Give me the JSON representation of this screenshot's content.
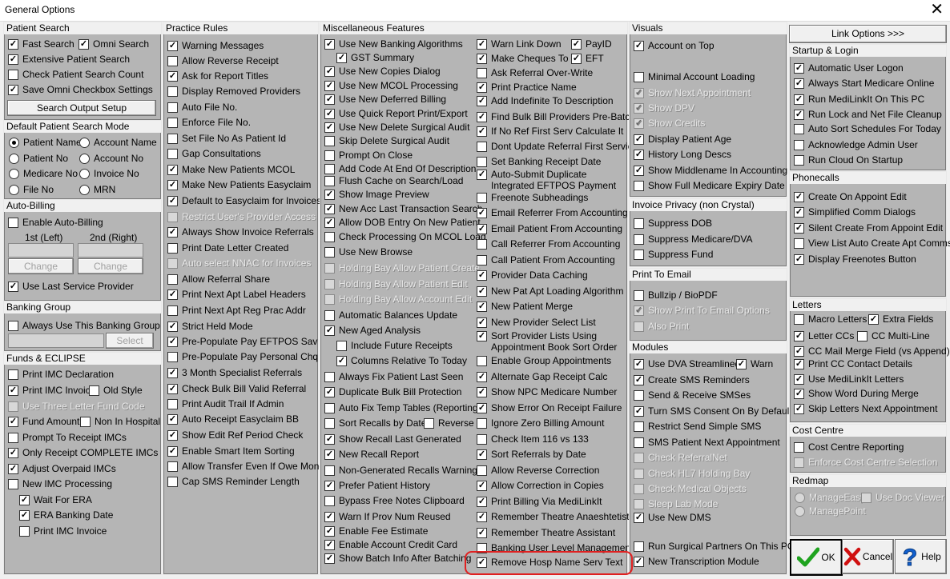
{
  "window": {
    "title": "General Options",
    "close_glyph": "✕"
  },
  "colors": {
    "panel_bg": "#b5b5b5",
    "highlight": "#e02020",
    "ok_check": "#1fa31f",
    "cancel_x": "#d01010",
    "help_q": "#1060d0"
  },
  "patient_search": {
    "title": "Patient Search",
    "items": [
      {
        "label": "Fast Search",
        "checked": true
      },
      {
        "label": "Omni Search",
        "checked": true
      },
      {
        "label": "Extensive Patient Search",
        "checked": true
      },
      {
        "label": "Check Patient Search Count",
        "checked": false
      },
      {
        "label": "Save Omni Checkbox Settings",
        "checked": true
      }
    ],
    "output_button": "Search Output Setup"
  },
  "default_search_mode": {
    "title": "Default Patient Search Mode",
    "options": [
      {
        "label": "Patient Name",
        "selected": true
      },
      {
        "label": "Account Name",
        "selected": false
      },
      {
        "label": "Patient No",
        "selected": false
      },
      {
        "label": "Account No",
        "selected": false
      },
      {
        "label": "Medicare No",
        "selected": false
      },
      {
        "label": "Invoice No",
        "selected": false
      },
      {
        "label": "File No",
        "selected": false
      },
      {
        "label": "MRN",
        "selected": false
      }
    ]
  },
  "auto_billing": {
    "title": "Auto-Billing",
    "enable": {
      "label": "Enable Auto-Billing",
      "checked": false
    },
    "first_label": "1st (Left)",
    "second_label": "2nd (Right)",
    "change1": "Change",
    "change2": "Change",
    "last_provider": {
      "label": "Use Last Service Provider",
      "checked": true
    }
  },
  "banking_group": {
    "title": "Banking Group",
    "always": {
      "label": "Always Use This Banking Group",
      "checked": false
    },
    "select_button": "Select"
  },
  "funds": {
    "title": "Funds & ECLIPSE",
    "items": [
      {
        "label": "Print IMC Declaration",
        "checked": false
      },
      {
        "label": "Print IMC Invoice",
        "checked": true
      },
      {
        "label": "Old Style",
        "checked": false
      },
      {
        "label": "Use Three Letter Fund Code",
        "checked": false,
        "disabled": true
      },
      {
        "label": "Fund Amount",
        "checked": true
      },
      {
        "label": "Non In Hospital",
        "checked": false
      },
      {
        "label": "Prompt To Receipt IMCs",
        "checked": false
      },
      {
        "label": "Only Receipt COMPLETE IMCs",
        "checked": true
      },
      {
        "label": "Adjust Overpaid IMCs",
        "checked": true
      },
      {
        "label": "New IMC Processing",
        "checked": false
      },
      {
        "label": "Wait For ERA",
        "checked": true
      },
      {
        "label": "ERA Banking Date",
        "checked": true
      },
      {
        "label": "Print IMC Invoice",
        "checked": false
      }
    ]
  },
  "practice_rules": {
    "title": "Practice Rules",
    "items": [
      {
        "label": "Warning Messages",
        "checked": true
      },
      {
        "label": "Allow Reverse Receipt",
        "checked": false
      },
      {
        "label": "Ask for Report Titles",
        "checked": true
      },
      {
        "label": "Display Removed Providers",
        "checked": false
      },
      {
        "label": "Auto File No.",
        "checked": false
      },
      {
        "label": "Enforce File No.",
        "checked": false
      },
      {
        "label": "Set File No As Patient Id",
        "checked": false
      },
      {
        "label": "Gap Consultations",
        "checked": false
      },
      {
        "label": "Make New Patients MCOL",
        "checked": true
      },
      {
        "label": "Make New Patients Easyclaim",
        "checked": true
      },
      {
        "label": "Default to Easyclaim for Invoices",
        "checked": true
      },
      {
        "label": "Restrict User's Provider Access",
        "checked": false,
        "disabled": true
      },
      {
        "label": "Always Show Invoice Referrals",
        "checked": true
      },
      {
        "label": "Print Date Letter Created",
        "checked": false
      },
      {
        "label": "Auto select NNAC for Invoices",
        "checked": false,
        "disabled": true
      },
      {
        "label": "Allow Referral Share",
        "checked": false
      },
      {
        "label": "Print Next Apt Label Headers",
        "checked": true
      },
      {
        "label": "Print Next Apt Reg Prac Addr",
        "checked": false
      },
      {
        "label": "Strict Held Mode",
        "checked": true
      },
      {
        "label": "Pre-Populate Pay EFTPOS Sav",
        "checked": true
      },
      {
        "label": "Pre-Populate Pay Personal Chq",
        "checked": false
      },
      {
        "label": "3 Month Specialist Referrals",
        "checked": true
      },
      {
        "label": "Check Bulk Bill Valid Referral",
        "checked": true
      },
      {
        "label": "Print Audit Trail If Admin",
        "checked": false
      },
      {
        "label": "Auto Receipt Easyclaim BB",
        "checked": true
      },
      {
        "label": "Show Edit Ref Period Check",
        "checked": true
      },
      {
        "label": "Enable Smart Item Sorting",
        "checked": true
      },
      {
        "label": "Allow Transfer Even If Owe Money",
        "checked": false
      },
      {
        "label": "Cap SMS Reminder Length",
        "checked": false
      }
    ]
  },
  "misc": {
    "title": "Miscellaneous Features",
    "col1": [
      {
        "label": "Use New Banking Algorithms",
        "checked": true
      },
      {
        "label": "GST Summary",
        "checked": true
      },
      {
        "label": "Use New Copies Dialog",
        "checked": true
      },
      {
        "label": "Use New MCOL Processing",
        "checked": true
      },
      {
        "label": "Use New Deferred Billing",
        "checked": true
      },
      {
        "label": "Use Quick Report Print/Export",
        "checked": true
      },
      {
        "label": "Use New Delete Surgical Audit",
        "checked": true
      },
      {
        "label": "Skip Delete Surgical Audit",
        "checked": false
      },
      {
        "label": "Prompt On Close",
        "checked": false
      },
      {
        "label": "Add Code At End Of Description",
        "checked": false
      },
      {
        "label": "Flush Cache on Search/Load",
        "checked": false
      },
      {
        "label": "Show Image Preview",
        "checked": true
      },
      {
        "label": "New Acc Last Transaction Search",
        "checked": true
      },
      {
        "label": "Allow DOB Entry On New Patient",
        "checked": true
      },
      {
        "label": "Check Processing On MCOL Load",
        "checked": false
      },
      {
        "label": "Use New Browse",
        "checked": false
      },
      {
        "label": "Holding Bay Allow Patient Create",
        "checked": false,
        "disabled": true
      },
      {
        "label": "Holding Bay Allow Patient Edit",
        "checked": false,
        "disabled": true
      },
      {
        "label": "Holding Bay Allow Account Edit",
        "checked": false,
        "disabled": true
      },
      {
        "label": "Automatic Balances Update",
        "checked": false
      },
      {
        "label": "New Aged Analysis",
        "checked": true
      },
      {
        "label": "Include Future Receipts",
        "checked": false
      },
      {
        "label": "Columns Relative To Today",
        "checked": true
      },
      {
        "label": "Always Fix Patient Last Seen",
        "checked": false
      },
      {
        "label": "Duplicate Bulk Bill Protection",
        "checked": true
      },
      {
        "label": "Auto Fix Temp Tables (Reporting)",
        "checked": false
      },
      {
        "label": "Sort Recalls by Date",
        "checked": false
      },
      {
        "label": "Reverse",
        "checked": false
      },
      {
        "label": "Show Recall Last Generated",
        "checked": true
      },
      {
        "label": "New Recall Report",
        "checked": true
      },
      {
        "label": "Non-Generated Recalls Warning",
        "checked": false
      },
      {
        "label": "Prefer Patient History",
        "checked": true
      },
      {
        "label": "Bypass Free Notes Clipboard",
        "checked": false
      },
      {
        "label": "Warn If Prov Num Reused",
        "checked": true
      },
      {
        "label": "Enable Fee Estimate",
        "checked": true
      },
      {
        "label": "Enable Account Credit Card",
        "checked": true
      },
      {
        "label": "Show Batch Info After Batching",
        "checked": true
      }
    ],
    "col2": [
      {
        "label": "Warn Link Down",
        "checked": true
      },
      {
        "label": "PayID",
        "checked": true
      },
      {
        "label": "Make Cheques To",
        "checked": true
      },
      {
        "label": "EFT",
        "checked": true
      },
      {
        "label": "Ask Referral Over-Write",
        "checked": false
      },
      {
        "label": "Print Practice Name",
        "checked": true
      },
      {
        "label": "Add Indefinite To Description",
        "checked": true
      },
      {
        "label": "Find Bulk Bill Providers Pre-Batch",
        "checked": true
      },
      {
        "label": "If No Ref First Serv Calculate It",
        "checked": true
      },
      {
        "label": "Dont Update Referral First Service",
        "checked": false
      },
      {
        "label": "Set Banking Receipt Date",
        "checked": false
      },
      {
        "label": "Auto-Submit Duplicate",
        "checked": true
      },
      {
        "label": "Integrated EFTPOS Payment",
        "checked": true
      },
      {
        "label": "Freenote Subheadings",
        "checked": false
      },
      {
        "label": "Email Referrer From Accounting",
        "checked": true
      },
      {
        "label": "Email Patient From Accounting",
        "checked": true
      },
      {
        "label": "Call Referrer From Accounting",
        "checked": false
      },
      {
        "label": "Call Patient From Accounting",
        "checked": false
      },
      {
        "label": "Provider Data Caching",
        "checked": true
      },
      {
        "label": "New Pat Apt Loading Algorithm",
        "checked": true
      },
      {
        "label": "New Patient Merge",
        "checked": true
      },
      {
        "label": "New Provider Select List",
        "checked": true
      },
      {
        "label": "Sort Provider Lists Using",
        "checked": true
      },
      {
        "label": "Appointment Book Sort Order",
        "checked": true
      },
      {
        "label": "Enable Group Appointments",
        "checked": false
      },
      {
        "label": "Alternate Gap Receipt Calc",
        "checked": true
      },
      {
        "label": "Show NPC Medicare Number",
        "checked": true
      },
      {
        "label": "Show Error On Receipt Failure",
        "checked": true
      },
      {
        "label": "Ignore Zero Billing Amount",
        "checked": false
      },
      {
        "label": "Check Item 116 vs 133",
        "checked": false
      },
      {
        "label": "Sort Referrals by Date",
        "checked": true
      },
      {
        "label": "Allow Reverse Correction",
        "checked": false
      },
      {
        "label": "Allow Correction in Copies",
        "checked": true
      },
      {
        "label": "Print Billing Via MediLinkIt",
        "checked": true
      },
      {
        "label": "Remember Theatre Anaeshtetist",
        "checked": true
      },
      {
        "label": "Remember Theatre Assistant",
        "checked": true
      },
      {
        "label": "Banking User Level Management",
        "checked": false
      },
      {
        "label": "Remove Hosp Name Serv Text",
        "checked": true
      }
    ]
  },
  "visuals": {
    "title": "Visuals",
    "items": [
      {
        "label": "Account on Top",
        "checked": true
      },
      {
        "label": "Minimal Account Loading",
        "checked": false
      },
      {
        "label": "Show Next Appointment",
        "checked": true,
        "disabled": true
      },
      {
        "label": "Show DPV",
        "checked": true,
        "disabled": true
      },
      {
        "label": "Show Credits",
        "checked": true,
        "disabled": true
      },
      {
        "label": "Display Patient Age",
        "checked": true
      },
      {
        "label": "History Long Descs",
        "checked": true
      },
      {
        "label": "Show Middlename In Accounting",
        "checked": true
      },
      {
        "label": "Show Full Medicare Expiry Date",
        "checked": false
      }
    ]
  },
  "privacy": {
    "title": "Invoice Privacy (non Crystal)",
    "items": [
      {
        "label": "Suppress DOB",
        "checked": false
      },
      {
        "label": "Suppress Medicare/DVA",
        "checked": false
      },
      {
        "label": "Suppress Fund",
        "checked": false
      }
    ]
  },
  "print_email": {
    "title": "Print To Email",
    "items": [
      {
        "label": "Bullzip / BioPDF",
        "checked": false
      },
      {
        "label": "Show Print To Email Options",
        "checked": true,
        "disabled": true
      },
      {
        "label": "Also Print",
        "checked": false,
        "disabled": true
      }
    ]
  },
  "modules": {
    "title": "Modules",
    "items": [
      {
        "label": "Use DVA Streamlined",
        "checked": true
      },
      {
        "label": "Warn",
        "checked": true
      },
      {
        "label": "Create SMS Reminders",
        "checked": true
      },
      {
        "label": "Send & Receive SMSes",
        "checked": false
      },
      {
        "label": "Turn SMS Consent On By Default",
        "checked": true
      },
      {
        "label": "Restrict Send Simple SMS",
        "checked": false
      },
      {
        "label": "SMS Patient Next Appointment",
        "checked": false
      },
      {
        "label": "Check ReferralNet",
        "checked": false,
        "disabled": true
      },
      {
        "label": "Check HL7 Holding Bay",
        "checked": false,
        "disabled": true
      },
      {
        "label": "Check Medical Objects",
        "checked": false,
        "disabled": true
      },
      {
        "label": "Sleep Lab Mode",
        "checked": false,
        "disabled": true
      },
      {
        "label": "Use New DMS",
        "checked": true
      },
      {
        "label": "Run Surgical Partners On This PC",
        "checked": false
      },
      {
        "label": "New Transcription Module",
        "checked": true
      }
    ]
  },
  "link_options": "Link Options >>>",
  "startup": {
    "title": "Startup & Login",
    "items": [
      {
        "label": "Automatic User Logon",
        "checked": true
      },
      {
        "label": "Always Start Medicare Online",
        "checked": true
      },
      {
        "label": "Run MediLinkIt On This PC",
        "checked": true
      },
      {
        "label": "Run Lock and Net File Cleanup",
        "checked": true
      },
      {
        "label": "Auto Sort Schedules For Today",
        "checked": false
      },
      {
        "label": "Acknowledge Admin User",
        "checked": false
      },
      {
        "label": "Run Cloud On Startup",
        "checked": false
      }
    ]
  },
  "phonecalls": {
    "title": "Phonecalls",
    "items": [
      {
        "label": "Create On Appoint Edit",
        "checked": true
      },
      {
        "label": "Simplified Comm Dialogs",
        "checked": true
      },
      {
        "label": "Silent Create From Appoint Edit",
        "checked": true
      },
      {
        "label": "View List Auto Create Apt Comms",
        "checked": false
      },
      {
        "label": "Display Freenotes Button",
        "checked": true
      }
    ]
  },
  "letters": {
    "title": "Letters",
    "items": [
      {
        "label": "Macro Letters",
        "checked": false
      },
      {
        "label": "Extra Fields",
        "checked": true
      },
      {
        "label": "Letter CCs",
        "checked": true
      },
      {
        "label": "CC Multi-Line",
        "checked": false
      },
      {
        "label": "CC Mail Merge Field (vs Append)",
        "checked": true
      },
      {
        "label": "Print CC Contact Details",
        "checked": true
      },
      {
        "label": "Use MediLinkIt Letters",
        "checked": true
      },
      {
        "label": "Show Word During Merge",
        "checked": true
      },
      {
        "label": "Skip Letters Next Appointment",
        "checked": true
      }
    ]
  },
  "cost_centre": {
    "title": "Cost Centre",
    "items": [
      {
        "label": "Cost Centre Reporting",
        "checked": false
      },
      {
        "label": "Enforce Cost Centre Selection",
        "checked": false,
        "disabled": true
      }
    ]
  },
  "redmap": {
    "title": "Redmap",
    "items": [
      {
        "label": "ManageEasy",
        "selected": false
      },
      {
        "label": "ManagePoint",
        "selected": false
      },
      {
        "label": "Use Doc Viewer",
        "checked": false
      }
    ]
  },
  "buttons": {
    "ok": "OK",
    "cancel": "Cancel",
    "help": "Help"
  }
}
